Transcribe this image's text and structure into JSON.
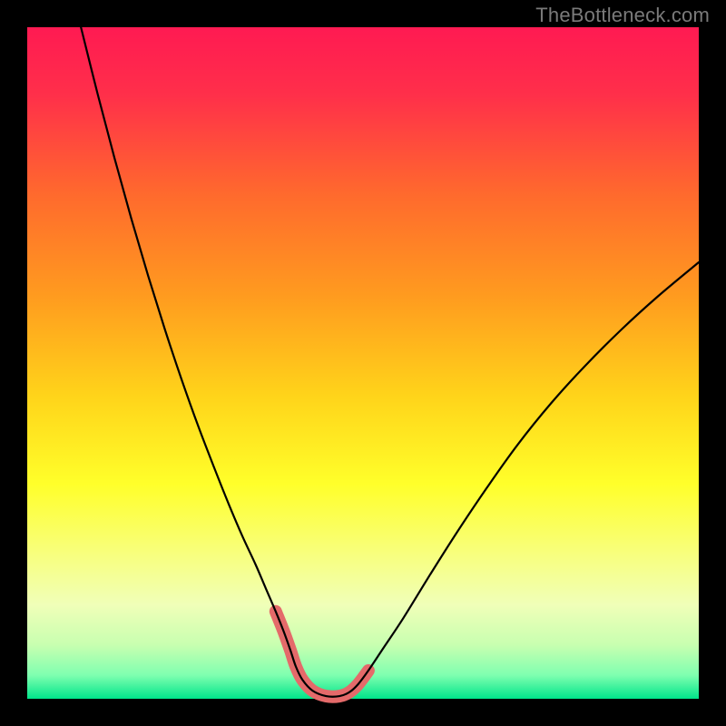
{
  "watermark": "TheBottleneck.com",
  "chart_data": {
    "type": "line",
    "title": "",
    "xlabel": "",
    "ylabel": "",
    "xlim": [
      0,
      100
    ],
    "ylim": [
      0,
      100
    ],
    "background_gradient": {
      "stops": [
        {
          "offset": 0.0,
          "color": "#ff1a52"
        },
        {
          "offset": 0.1,
          "color": "#ff2f4a"
        },
        {
          "offset": 0.25,
          "color": "#ff6a2d"
        },
        {
          "offset": 0.4,
          "color": "#ff9b1f"
        },
        {
          "offset": 0.55,
          "color": "#ffd41a"
        },
        {
          "offset": 0.68,
          "color": "#ffff2a"
        },
        {
          "offset": 0.78,
          "color": "#f8ff7a"
        },
        {
          "offset": 0.86,
          "color": "#f0ffb8"
        },
        {
          "offset": 0.92,
          "color": "#c8ffb0"
        },
        {
          "offset": 0.965,
          "color": "#7fffb0"
        },
        {
          "offset": 1.0,
          "color": "#00e58a"
        }
      ]
    },
    "series": [
      {
        "name": "curve",
        "color": "#000000",
        "stroke_width": 2.2,
        "x": [
          8.0,
          10.5,
          13.0,
          15.5,
          18.0,
          20.5,
          23.0,
          25.5,
          28.0,
          30.0,
          32.0,
          34.0,
          35.5,
          37.0,
          38.2,
          39.2,
          40.0,
          41.0,
          42.5,
          44.5,
          46.5,
          48.0,
          49.3,
          50.8,
          53.0,
          56.0,
          60.0,
          64.0,
          68.5,
          73.0,
          78.0,
          83.0,
          88.5,
          94.0,
          100.0
        ],
        "y": [
          100.0,
          90.0,
          80.5,
          71.5,
          63.0,
          55.0,
          47.5,
          40.5,
          34.0,
          29.0,
          24.3,
          20.0,
          16.5,
          13.0,
          10.0,
          7.2,
          4.8,
          2.8,
          1.2,
          0.4,
          0.4,
          1.0,
          2.2,
          4.2,
          7.5,
          12.0,
          18.5,
          24.8,
          31.5,
          37.8,
          44.0,
          49.5,
          55.0,
          60.0,
          65.0
        ]
      },
      {
        "name": "highlight",
        "color": "#e46a6a",
        "stroke_width": 14,
        "x": [
          37.0,
          38.2,
          39.2,
          40.0,
          41.0,
          42.5,
          44.5,
          46.5,
          48.0,
          49.3,
          50.8
        ],
        "y": [
          13.0,
          10.0,
          7.2,
          4.8,
          2.8,
          1.2,
          0.4,
          0.4,
          1.0,
          2.2,
          4.2
        ]
      }
    ]
  }
}
